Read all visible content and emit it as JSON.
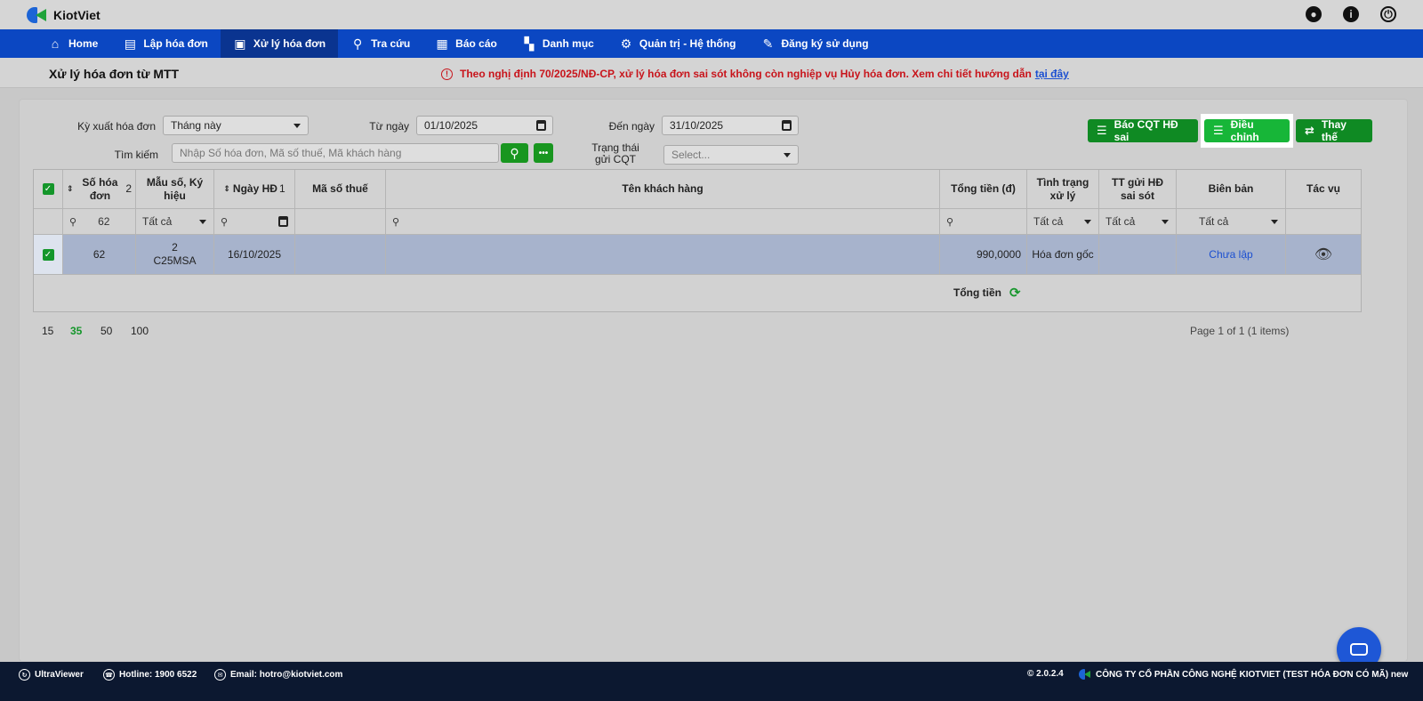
{
  "app": {
    "name": "KiotViet"
  },
  "top_icons": [
    "user-circle-icon",
    "info-icon",
    "power-icon"
  ],
  "nav": [
    {
      "label": "Home",
      "icon": "home-icon"
    },
    {
      "label": "Lập hóa đơn",
      "icon": "invoice-create-icon"
    },
    {
      "label": "Xử lý hóa đơn",
      "icon": "invoice-process-icon",
      "active": true
    },
    {
      "label": "Tra cứu",
      "icon": "search-icon"
    },
    {
      "label": "Báo cáo",
      "icon": "report-icon"
    },
    {
      "label": "Danh mục",
      "icon": "grid-icon"
    },
    {
      "label": "Quản trị - Hệ thống",
      "icon": "admin-icon"
    },
    {
      "label": "Đăng ký sử dụng",
      "icon": "register-icon"
    }
  ],
  "page": {
    "title": "Xử lý hóa đơn từ MTT",
    "notice": "Theo nghị định 70/2025/NĐ-CP, xử lý hóa đơn sai sót không còn nghiệp vụ Hủy hóa đơn. Xem chi tiết hướng dẫn",
    "notice_link": "tại đây"
  },
  "filters": {
    "period_label": "Kỳ xuất hóa đơn",
    "period_value": "Tháng này",
    "from_label": "Từ ngày",
    "from_value": "01/10/2025",
    "to_label": "Đến ngày",
    "to_value": "31/10/2025",
    "search_label": "Tìm kiếm",
    "search_placeholder": "Nhập Số hóa đơn, Mã số thuế, Mã khách hàng",
    "status_label_1": "Trạng thái",
    "status_label_2": "gửi CQT",
    "status_placeholder": "Select..."
  },
  "actions": {
    "report_wrong": "Báo CQT HĐ sai",
    "adjust": "Điều chỉnh",
    "replace": "Thay thế"
  },
  "table": {
    "headers": {
      "so_hd": "Số hóa đơn",
      "so_hd_sort": "2",
      "mau_so": "Mẫu số, Ký hiệu",
      "ngay": "Ngày HĐ",
      "ngay_sort": "1",
      "mst": "Mã số thuế",
      "ten_kh": "Tên khách hàng",
      "tong_tien": "Tổng tiền (đ)",
      "tinh_trang": "Tình trạng xử lý",
      "tt_gui": "TT gửi HĐ sai sót",
      "bien_ban": "Biên bản",
      "tac_vu": "Tác vụ"
    },
    "filters": {
      "so_hd": "62",
      "tinh_trang": "Tất cả",
      "tt_gui": "Tất cả",
      "bien_ban": "Tất cả",
      "mau_so": "Tất cả"
    },
    "rows": [
      {
        "so_hd": "62",
        "mau_so_1": "2",
        "mau_so_2": "C25MSA",
        "ngay": "16/10/2025",
        "mst": "",
        "ten_kh": "",
        "tong_tien": "990,0000",
        "tinh_trang": "Hóa đơn gốc",
        "tt_gui": "",
        "bien_ban": "Chưa lập"
      }
    ],
    "total_label": "Tổng tiền"
  },
  "pagination": {
    "sizes": [
      "15",
      "35",
      "50",
      "100"
    ],
    "active_size": "35",
    "info": "Page 1 of 1 (1 items)"
  },
  "footer": {
    "ultraviewer": "UltraViewer",
    "hotline": "Hotline: 1900 6522",
    "email": "Email: hotro@kiotviet.com",
    "version": "© 2.0.2.4",
    "company": "CÔNG TY CỔ PHẦN CÔNG NGHỆ KIOTVIET (TEST HÓA ĐƠN CÓ MÃ) new"
  }
}
